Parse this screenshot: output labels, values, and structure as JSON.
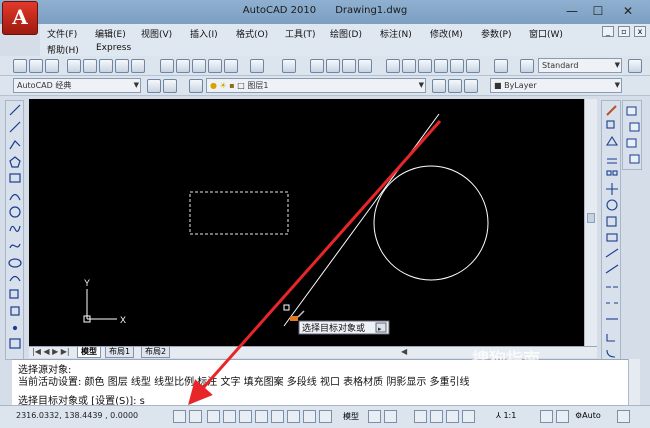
{
  "window": {
    "app_letter": "A",
    "app_title": "AutoCAD 2010",
    "doc_title": "Drawing1.dwg",
    "minimize": "—",
    "maximize": "☐",
    "close": "✕"
  },
  "menu": {
    "items": [
      "文件(F)",
      "编辑(E)",
      "视图(V)",
      "插入(I)",
      "格式(O)",
      "工具(T)",
      "绘图(D)",
      "标注(N)",
      "修改(M)",
      "参数(P)",
      "窗口(W)"
    ],
    "row2": [
      "帮助(H)",
      "Express"
    ]
  },
  "toolbar": {
    "text_style": "Standard",
    "workspace": "AutoCAD 经典",
    "layer": "图层1",
    "bylayer": "ByLayer"
  },
  "canvas": {
    "axis_y": "Y",
    "axis_x": "X",
    "tooltip": "选择目标对象或"
  },
  "tabs": [
    "模型",
    "布局1",
    "布局2"
  ],
  "command": {
    "line1": "选择源对象:",
    "line2": "当前活动设置:  颜色 图层 线型 线型比例 标注 文字 填充图案 多段线 视口 表格材质 阴影显示 多重引线",
    "line3": "选择目标对象或 [设置(S)]: s"
  },
  "status": {
    "coords": "2316.0332, 138.4439 , 0.0000",
    "model": "模型",
    "scale": "1:1",
    "auto": "Auto"
  },
  "watermark": "搜狗指南"
}
